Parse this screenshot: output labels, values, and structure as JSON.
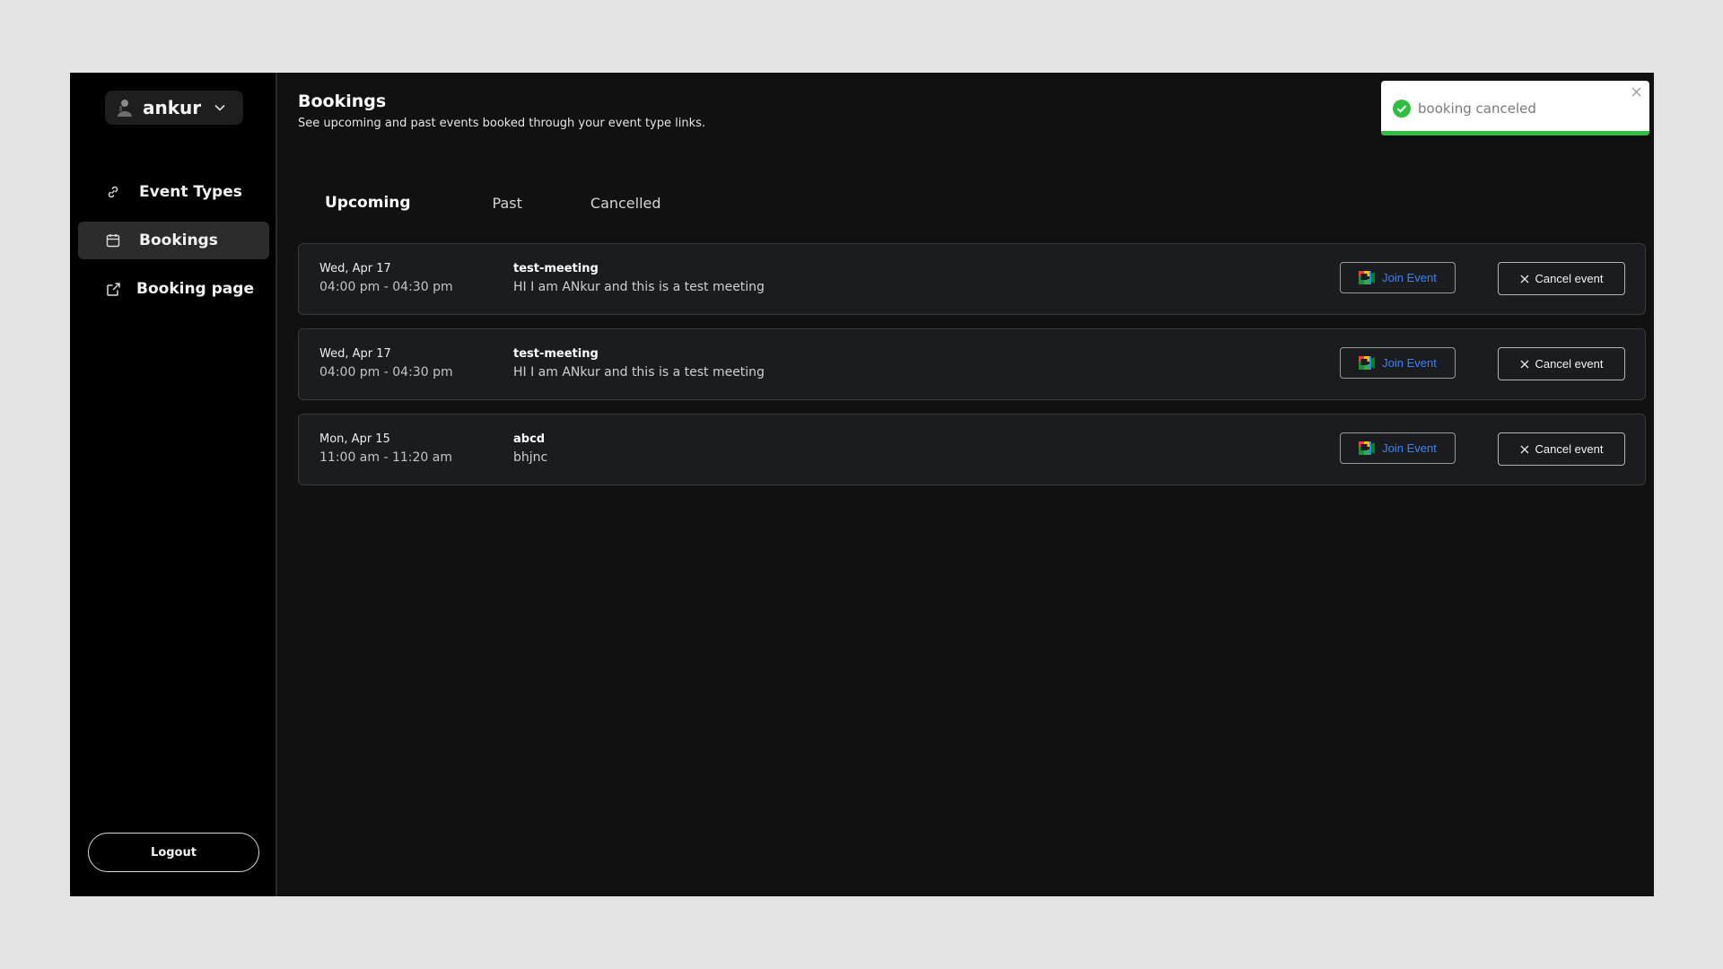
{
  "user": {
    "name": "ankur"
  },
  "sidebar": {
    "items": [
      {
        "label": "Event Types",
        "icon": "link-icon"
      },
      {
        "label": "Bookings",
        "icon": "calendar-icon",
        "active": true
      },
      {
        "label": "Booking page",
        "icon": "external-link-icon"
      }
    ],
    "logout_label": "Logout"
  },
  "header": {
    "title": "Bookings",
    "subtitle": "See upcoming and past events booked through your event type links."
  },
  "tabs": [
    {
      "label": "Upcoming",
      "active": true
    },
    {
      "label": "Past"
    },
    {
      "label": "Cancelled"
    }
  ],
  "bookings": [
    {
      "date": "Wed, Apr 17",
      "time": "04:00 pm - 04:30 pm",
      "name": "test-meeting",
      "description": "HI I am ANkur and this is a test meeting",
      "join_label": "Join Event",
      "cancel_label": "Cancel event"
    },
    {
      "date": "Wed, Apr 17",
      "time": "04:00 pm - 04:30 pm",
      "name": "test-meeting",
      "description": "HI I am ANkur and this is a test meeting",
      "join_label": "Join Event",
      "cancel_label": "Cancel event"
    },
    {
      "date": "Mon, Apr 15",
      "time": "11:00 am - 11:20 am",
      "name": "abcd",
      "description": "bhjnc",
      "join_label": "Join Event",
      "cancel_label": "Cancel event"
    }
  ],
  "toast": {
    "message": "booking canceled",
    "progress": 1.0
  },
  "colors": {
    "accent_blue": "#3b82f6",
    "success_green": "#2fbf40",
    "background": "#111111"
  }
}
